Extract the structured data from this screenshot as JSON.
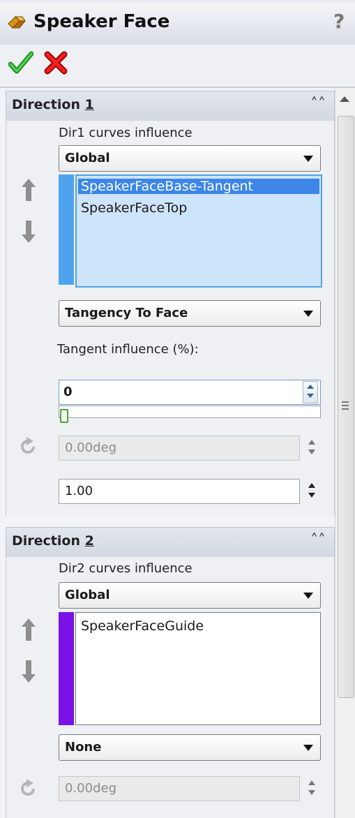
{
  "window": {
    "title": "Speaker Face",
    "help_label": "?"
  },
  "toolbar": {
    "ok_icon": "checkmark-icon",
    "cancel_icon": "x-icon",
    "ok_color": "#2aa52a",
    "cancel_color": "#d01010"
  },
  "direction1": {
    "header": "Direction 1",
    "curves_label": "Dir1 curves influence",
    "curves_value": "Global",
    "list_color": "#4fa3ee",
    "list_items": [
      "SpeakerFaceBase-Tangent",
      "SpeakerFaceTop"
    ],
    "selected_index": 0,
    "tangency_value": "Tangency To Face",
    "tangent_label": "Tangent influence (%):",
    "tangent_value": "0",
    "tangent_slider_fraction": 0,
    "angle_value": "0.00deg",
    "weight_value": "1.00"
  },
  "direction2": {
    "header": "Direction 2",
    "curves_label": "Dir2 curves influence",
    "curves_value": "Global",
    "list_color": "#7a12e6",
    "list_items": [
      "SpeakerFaceGuide"
    ],
    "tangency_value": "None",
    "angle_value": "0.00deg"
  }
}
